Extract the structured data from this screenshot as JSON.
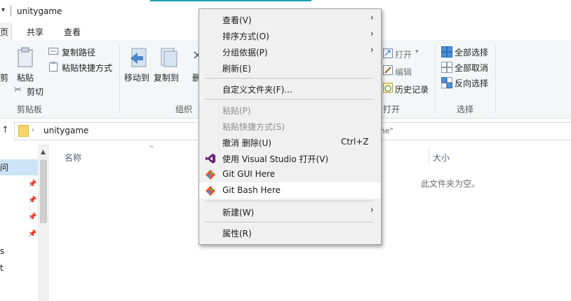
{
  "window": {
    "title": "unitygame",
    "title_dropdown": "▾"
  },
  "ribbon_tabs": {
    "home": "页",
    "share": "共享",
    "view": "查看"
  },
  "ribbon": {
    "cut_partial": "剪",
    "copy_path": "复制路径",
    "paste_shortcut": "粘贴快捷方式",
    "paste": "粘贴",
    "cut": "剪切",
    "clipboard_group": "剪贴板",
    "move_to": "移动到",
    "copy_to": "复制到",
    "delete_partial": "删",
    "organize_group": "组织",
    "open": "打开",
    "edit": "编辑",
    "history": "历史记录",
    "open_group": "打开",
    "select_all": "全部选择",
    "select_none": "全部取消",
    "invert_selection": "反向选择",
    "select_group": "选择"
  },
  "address": {
    "path": "unitygame",
    "search_fragment": "me\""
  },
  "nav": {
    "quick_access": "问",
    "item_s": "s",
    "item_t": "t"
  },
  "content": {
    "col_name": "名称",
    "col_size": "大小",
    "empty_message": "此文件夹为空。"
  },
  "menu": {
    "view": "查看(V)",
    "sort": "排序方式(O)",
    "group": "分组依据(P)",
    "refresh": "刷新(E)",
    "customize": "自定义文件夹(F)...",
    "paste": "粘贴(P)",
    "paste_shortcut": "粘贴快捷方式(S)",
    "undo_delete": "撤消 删除(U)",
    "undo_shortcut": "Ctrl+Z",
    "open_vs": "使用 Visual Studio 打开(V)",
    "git_gui": "Git GUI Here",
    "git_bash": "Git Bash Here",
    "new": "新建(W)",
    "properties": "属性(R)",
    "submenu_arrow": "›"
  },
  "colors": {
    "accent_selection": "#cce4f7",
    "menu_bg": "#f0f0f0",
    "vs_purple": "#68217a",
    "git_orange": "#f05133"
  }
}
